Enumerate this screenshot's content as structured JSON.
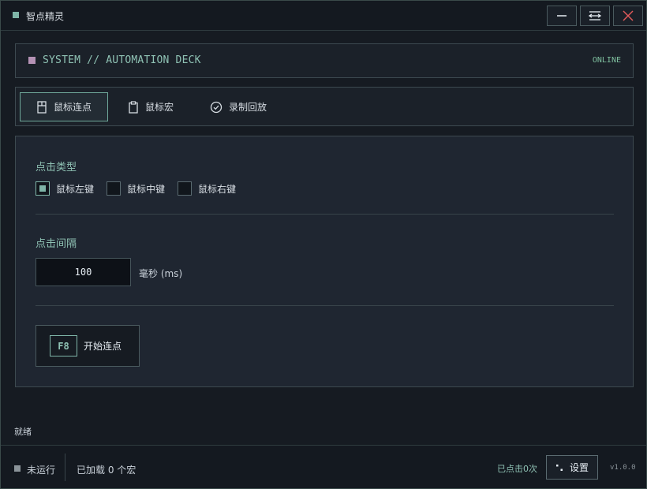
{
  "window": {
    "title": "智点精灵",
    "controls": {
      "minimize_icon": "minimize-icon",
      "layout_icon": "layout-toggle-icon",
      "close_icon": "close-icon"
    }
  },
  "header": {
    "title": "SYSTEM // AUTOMATION DECK",
    "status": "ONLINE"
  },
  "tabs": [
    {
      "label": "鼠标连点",
      "icon": "mouse-icon",
      "active": true
    },
    {
      "label": "鼠标宏",
      "icon": "clipboard-icon",
      "active": false
    },
    {
      "label": "录制回放",
      "icon": "check-circle-icon",
      "active": false
    }
  ],
  "click_type": {
    "label": "点击类型",
    "options": [
      {
        "label": "鼠标左键",
        "checked": true
      },
      {
        "label": "鼠标中键",
        "checked": false
      },
      {
        "label": "鼠标右键",
        "checked": false
      }
    ]
  },
  "interval": {
    "label": "点击间隔",
    "value": "100",
    "unit": "毫秒 (ms)"
  },
  "start": {
    "hotkey": "F8",
    "label": "开始连点"
  },
  "log": {
    "status": "就绪"
  },
  "footer": {
    "run_state": "未运行",
    "loaded": "已加载 0 个宏",
    "click_count": "已点击0次",
    "settings_label": "设置",
    "version": "v1.0.0"
  },
  "colors": {
    "accent": "#7fb5a8",
    "background": "#161b22",
    "panel": "#1f2631",
    "danger": "#e05a5a",
    "header_square": "#b592b5"
  }
}
